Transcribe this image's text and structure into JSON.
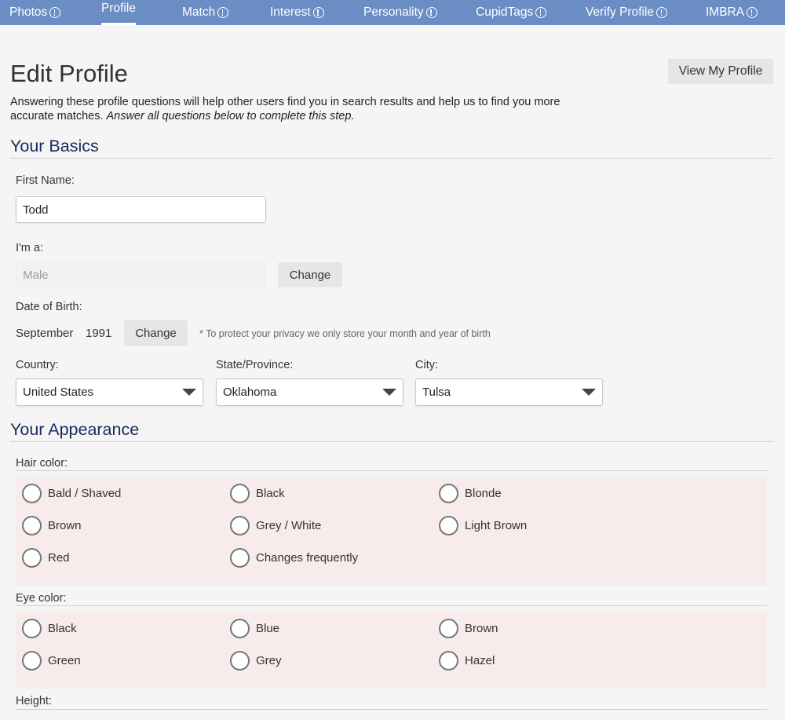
{
  "nav": {
    "tabs": [
      {
        "label": "Photos",
        "active": false
      },
      {
        "label": "Profile",
        "active": true
      },
      {
        "label": "Match",
        "active": false
      },
      {
        "label": "Interest",
        "active": false
      },
      {
        "label": "Personality",
        "active": false
      },
      {
        "label": "CupidTags",
        "active": false
      },
      {
        "label": "Verify Profile",
        "active": false
      },
      {
        "label": "IMBRA",
        "active": false
      }
    ]
  },
  "header": {
    "title": "Edit Profile",
    "view_profile_label": "View My Profile",
    "intro_text": "Answering these profile questions will help other users find you in search results and help us to find you more accurate matches. ",
    "intro_emphasis": "Answer all questions below to complete this step."
  },
  "basics": {
    "section_title": "Your Basics",
    "first_name_label": "First Name:",
    "first_name_value": "Todd",
    "gender_label": "I'm a:",
    "gender_value": "Male",
    "gender_change_label": "Change",
    "dob_label": "Date of Birth:",
    "dob_month": "September",
    "dob_year": "1991",
    "dob_change_label": "Change",
    "dob_note": "* To protect your privacy we only store your month and year of birth",
    "country_label": "Country:",
    "country_value": "United States",
    "state_label": "State/Province:",
    "state_value": "Oklahoma",
    "city_label": "City:",
    "city_value": "Tulsa"
  },
  "appearance": {
    "section_title": "Your Appearance",
    "hair_label": "Hair color:",
    "hair_options": [
      "Bald / Shaved",
      "Black",
      "Blonde",
      "Brown",
      "Grey / White",
      "Light Brown",
      "Red",
      "Changes frequently"
    ],
    "eye_label": "Eye color:",
    "eye_options": [
      "Black",
      "Blue",
      "Brown",
      "Green",
      "Grey",
      "Hazel"
    ],
    "height_label": "Height:"
  },
  "colors": {
    "nav_bg": "#6a8dc4",
    "section_title": "#1a2a5c",
    "radio_group_bg": "#f7eceb"
  },
  "icons": {
    "nav_info": "info-circle-icon",
    "select_caret": "caret-down-icon",
    "radio": "radio-empty-icon"
  }
}
